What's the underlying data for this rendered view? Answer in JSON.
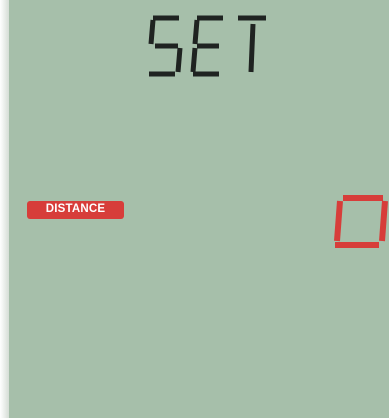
{
  "display": {
    "mode_text": "SET",
    "field_label": "DISTANCE",
    "field_value": "0",
    "colors": {
      "lcd_background": "#a6bfaa",
      "segment_dark": "#1f2321",
      "accent_red": "#d73d3a"
    }
  }
}
